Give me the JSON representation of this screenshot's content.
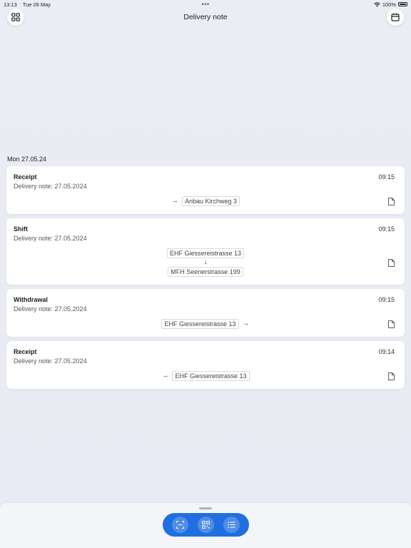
{
  "status_bar": {
    "time": "13:13",
    "date": "Tue 28 May",
    "dots": "•••",
    "battery_text": "100%"
  },
  "header": {
    "title": "Delivery note",
    "left_icon": "grid-icon",
    "right_icon": "calendar-icon"
  },
  "section": {
    "date_label": "Mon 27.05.24"
  },
  "entries": [
    {
      "type": "Receipt",
      "note": "Delivery note: 27.05.2024",
      "time": "09:15",
      "to": "Anbau Kirchweg 3",
      "arrow": "→"
    },
    {
      "type": "Shift",
      "note": "Delivery note: 27.05.2024",
      "time": "09:15",
      "from": "EHF Giessereistrasse 13",
      "to": "MFH Seenerstrasse 199",
      "arrow": "↓"
    },
    {
      "type": "Withdrawal",
      "note": "Delivery note: 27.05.2024",
      "time": "09:15",
      "from": "EHF Giessereistrasse 13",
      "arrow": "→"
    },
    {
      "type": "Receipt",
      "note": "Delivery note: 27.05.2024",
      "time": "09:14",
      "to": "EHF Giessereistrasse 13",
      "arrow": "→"
    }
  ],
  "toolbar": {
    "items": [
      "scan-frame-icon",
      "qr-code-icon",
      "list-icon"
    ],
    "color": "#1f6fe0"
  }
}
